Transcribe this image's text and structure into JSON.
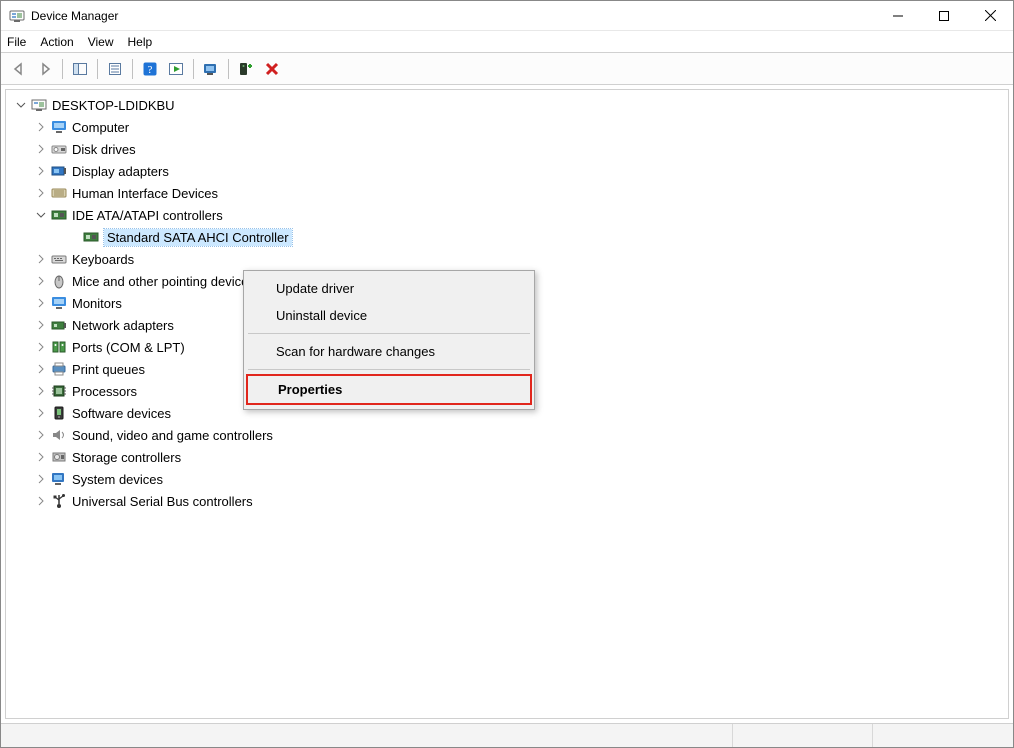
{
  "window": {
    "title": "Device Manager"
  },
  "menubar": {
    "file": "File",
    "action": "Action",
    "view": "View",
    "help": "Help"
  },
  "tree": {
    "root": "DESKTOP-LDIDKBU",
    "items": [
      {
        "label": "Computer"
      },
      {
        "label": "Disk drives"
      },
      {
        "label": "Display adapters"
      },
      {
        "label": "Human Interface Devices"
      },
      {
        "label": "IDE ATA/ATAPI controllers",
        "expanded": true,
        "children": [
          {
            "label": "Standard SATA AHCI Controller"
          }
        ]
      },
      {
        "label": "Keyboards"
      },
      {
        "label": "Mice and other pointing devices"
      },
      {
        "label": "Monitors"
      },
      {
        "label": "Network adapters"
      },
      {
        "label": "Ports (COM & LPT)"
      },
      {
        "label": "Print queues"
      },
      {
        "label": "Processors"
      },
      {
        "label": "Software devices"
      },
      {
        "label": "Sound, video and game controllers"
      },
      {
        "label": "Storage controllers"
      },
      {
        "label": "System devices"
      },
      {
        "label": "Universal Serial Bus controllers"
      }
    ]
  },
  "context_menu": {
    "update": "Update driver",
    "uninstall": "Uninstall device",
    "scan": "Scan for hardware changes",
    "properties": "Properties"
  }
}
